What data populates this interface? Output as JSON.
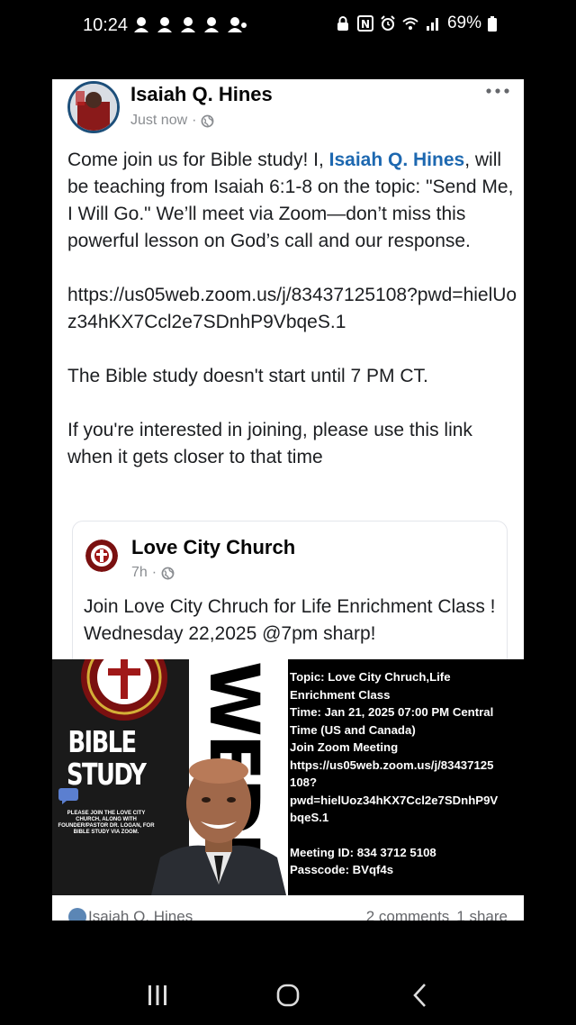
{
  "status_bar": {
    "time": "10:24",
    "battery": "69%",
    "notification_icons": [
      "notification-icon",
      "notification-icon",
      "notification-icon",
      "notification-icon",
      "notification-icon"
    ],
    "right_icons": [
      "lock-icon",
      "nfc-icon",
      "alarm-icon",
      "wifi-icon",
      "signal-icon",
      "battery-icon"
    ]
  },
  "post": {
    "author": "Isaiah Q. Hines",
    "time": "Just now",
    "text_intro": "Come join us for Bible study! I,",
    "text_mention": "Isaiah Q. Hines",
    "text_rest": ", will be teaching from Isaiah 6:1-8 on the topic: \"Send Me, I Will Go.\" We’ll meet via Zoom—don’t miss this powerful lesson on God’s call and our response.",
    "link": "https://us05web.zoom.us/j/83437125108?pwd=hielUoz34hKX7Ccl2e7SDnhP9VbqeS.1",
    "start_note": "The Bible study doesn't start until 7 PM CT.",
    "join_note": "If you're interested in joining, please use this link when it gets closer to that time"
  },
  "shared_post": {
    "author": "Love City Church",
    "time": "7h",
    "text": "Join Love City Chruch for Life Enrichment Class ! Wednesday 22,2025 @7pm sharp!"
  },
  "flyer": {
    "headline_line1": "BIBLE",
    "headline_line2": "STUDY",
    "vertical_text": "WEDNES",
    "small_text": "PLEASE JOIN THE LOVE CITY CHURCH, ALONG WITH FOUNDER/PASTOR DR. LOGAN, FOR BIBLE STUDY VIA ZOOM.",
    "zoom_details": [
      "Topic: Love City Chruch,Life",
      "Enrichment Class",
      "Time: Jan 21, 2025 07:00 PM Central",
      "Time (US and Canada)",
      "Join Zoom Meeting",
      "https://us05web.zoom.us/j/83437125",
      "108?",
      "pwd=hielUoz34hKX7Ccl2e7SDnhP9V",
      "bqeS.1"
    ],
    "meeting_id": "Meeting ID: 834 3712 5108",
    "passcode": "Passcode: BVqf4s"
  },
  "footer": {
    "name": "Isaiah Q. Hines",
    "comments": "2 comments",
    "shares": "1 share"
  },
  "nav": {
    "buttons": [
      "recent-apps-icon",
      "home-icon",
      "back-icon"
    ]
  },
  "colors": {
    "mention": "#1d68b0",
    "meta_grey": "#8a8d91",
    "avatar_ring": "#1d4f7a"
  }
}
